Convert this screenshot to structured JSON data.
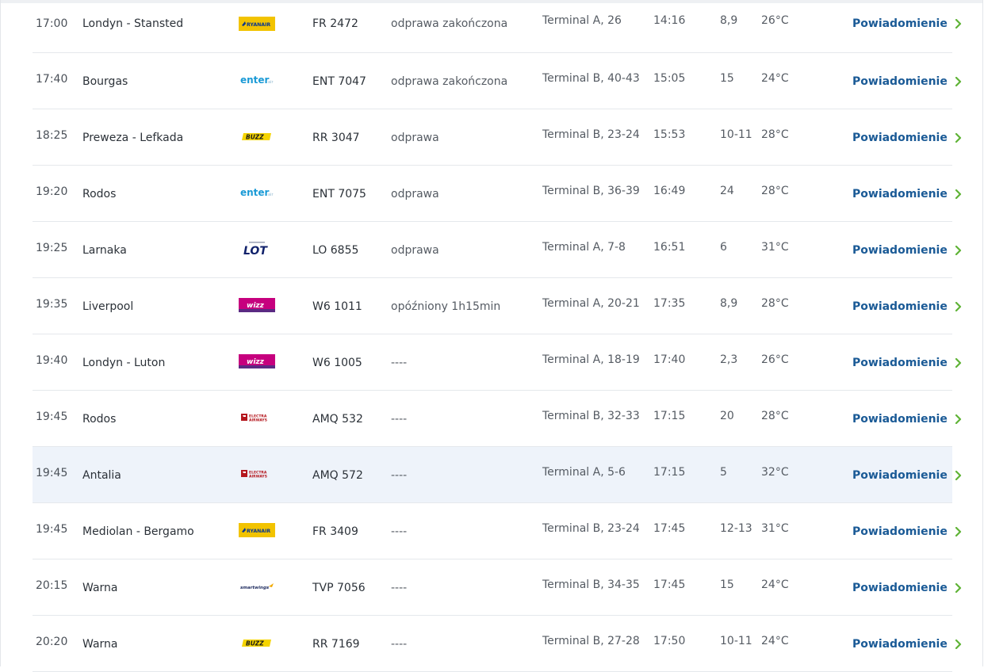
{
  "flights": [
    {
      "time": "17:00",
      "destination": "Londyn - Stansted",
      "airline": "ryanair",
      "flight": "FR 2472",
      "status": "odprawa zakończona",
      "terminal": "Terminal A, 26",
      "departure": "14:16",
      "gate": "8,9",
      "temp": "26°C",
      "notify": "Powiadomienie"
    },
    {
      "time": "17:40",
      "destination": "Bourgas",
      "airline": "enter-air",
      "flight": "ENT 7047",
      "status": "odprawa zakończona",
      "terminal": "Terminal B, 40-43",
      "departure": "15:05",
      "gate": "15",
      "temp": "24°C",
      "notify": "Powiadomienie"
    },
    {
      "time": "18:25",
      "destination": "Preweza - Lefkada",
      "airline": "buzz",
      "flight": "RR 3047",
      "status": "odprawa",
      "terminal": "Terminal B, 23-24",
      "departure": "15:53",
      "gate": "10-11",
      "temp": "28°C",
      "notify": "Powiadomienie"
    },
    {
      "time": "19:20",
      "destination": "Rodos",
      "airline": "enter-air",
      "flight": "ENT 7075",
      "status": "odprawa",
      "terminal": "Terminal B, 36-39",
      "departure": "16:49",
      "gate": "24",
      "temp": "28°C",
      "notify": "Powiadomienie"
    },
    {
      "time": "19:25",
      "destination": "Larnaka",
      "airline": "lot",
      "flight": "LO 6855",
      "status": "odprawa",
      "terminal": "Terminal A, 7-8",
      "departure": "16:51",
      "gate": "6",
      "temp": "31°C",
      "notify": "Powiadomienie"
    },
    {
      "time": "19:35",
      "destination": "Liverpool",
      "airline": "wizz",
      "flight": "W6 1011",
      "status": "opóźniony 1h15min",
      "terminal": "Terminal A, 20-21",
      "departure": "17:35",
      "gate": "8,9",
      "temp": "28°C",
      "notify": "Powiadomienie"
    },
    {
      "time": "19:40",
      "destination": "Londyn - Luton",
      "airline": "wizz",
      "flight": "W6 1005",
      "status": "----",
      "terminal": "Terminal A, 18-19",
      "departure": "17:40",
      "gate": "2,3",
      "temp": "26°C",
      "notify": "Powiadomienie"
    },
    {
      "time": "19:45",
      "destination": "Rodos",
      "airline": "electra",
      "flight": "AMQ 532",
      "status": "----",
      "terminal": "Terminal B, 32-33",
      "departure": "17:15",
      "gate": "20",
      "temp": "28°C",
      "notify": "Powiadomienie"
    },
    {
      "time": "19:45",
      "destination": "Antalia",
      "airline": "electra",
      "flight": "AMQ 572",
      "status": "----",
      "terminal": "Terminal A, 5-6",
      "departure": "17:15",
      "gate": "5",
      "temp": "32°C",
      "notify": "Powiadomienie",
      "highlight": true
    },
    {
      "time": "19:45",
      "destination": "Mediolan - Bergamo",
      "airline": "ryanair",
      "flight": "FR 3409",
      "status": "----",
      "terminal": "Terminal B, 23-24",
      "departure": "17:45",
      "gate": "12-13",
      "temp": "31°C",
      "notify": "Powiadomienie"
    },
    {
      "time": "20:15",
      "destination": "Warna",
      "airline": "smartwings",
      "flight": "TVP 7056",
      "status": "----",
      "terminal": "Terminal B, 34-35",
      "departure": "17:45",
      "gate": "15",
      "temp": "24°C",
      "notify": "Powiadomienie"
    },
    {
      "time": "20:20",
      "destination": "Warna",
      "airline": "buzz",
      "flight": "RR 7169",
      "status": "----",
      "terminal": "Terminal B, 27-28",
      "departure": "17:50",
      "gate": "10-11",
      "temp": "24°C",
      "notify": "Powiadomienie"
    }
  ],
  "logos": {
    "ryanair": "RYANAIR",
    "enter-air": "enter",
    "enter-air-suffix": "air",
    "buzz": "BUZZ",
    "lot": "LOT",
    "wizz": "wizz",
    "electra_line1": "ELECTRA",
    "electra_line2": "AIRWAYS",
    "smartwings": "smartwings"
  },
  "colors": {
    "notify_text": "#1a5a96",
    "chevron": "#5fb336",
    "row_highlight": "#eef3fa",
    "ryanair_bg": "#f2c300",
    "ryanair_text": "#073590",
    "enter_text": "#1a9ad6",
    "buzz_bg": "#f5d400",
    "lot_text": "#11226b",
    "wizz_bg": "#c6007e",
    "electra_red": "#b4161d"
  }
}
